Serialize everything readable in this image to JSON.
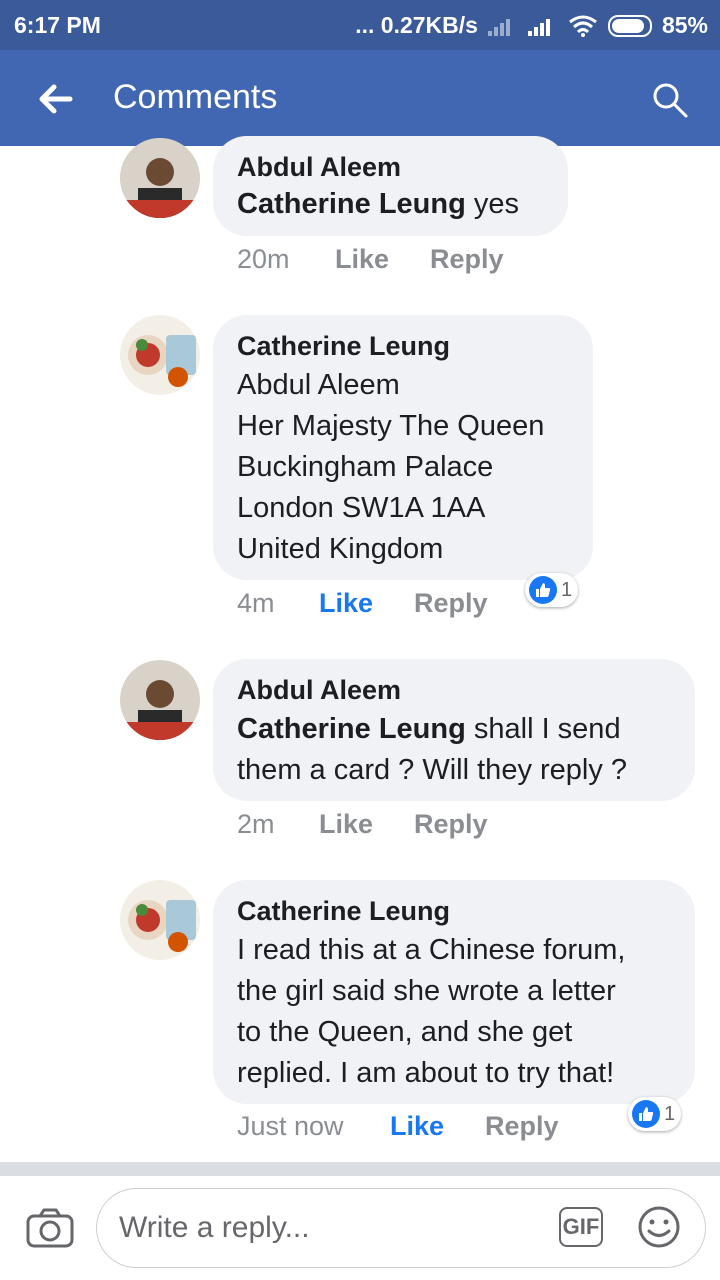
{
  "status_bar": {
    "time": "6:17 PM",
    "network_speed": "... 0.27KB/s",
    "battery": "85%"
  },
  "app_bar": {
    "title": "Comments",
    "back_icon": "arrow-left-icon",
    "search_icon": "search-icon"
  },
  "comments": [
    {
      "author": "Abdul Aleem",
      "mention": "Catherine Leung",
      "text": " yes",
      "time": "20m",
      "like_label": "Like",
      "reply_label": "Reply",
      "liked": false
    },
    {
      "author": "Catherine Leung",
      "mention": "",
      "text": "Abdul Aleem\nHer Majesty The Queen\nBuckingham Palace\nLondon SW1A 1AA\nUnited Kingdom",
      "time": "4m",
      "like_label": "Like",
      "reply_label": "Reply",
      "liked": true,
      "reaction_count": "1"
    },
    {
      "author": "Abdul Aleem",
      "mention": "Catherine Leung",
      "text": " shall I send\nthem a card ? Will they reply ?",
      "time": "2m",
      "like_label": "Like",
      "reply_label": "Reply",
      "liked": false
    },
    {
      "author": "Catherine Leung",
      "mention": "",
      "text": "I read this at a Chinese forum,\nthe girl said she wrote a letter\nto the Queen, and she get\nreplied. I am about to try that!",
      "time": "Just now",
      "like_label": "Like",
      "reply_label": "Reply",
      "liked": true,
      "reaction_count": "1"
    }
  ],
  "composer": {
    "placeholder": "Write a reply...",
    "gif_label": "GIF"
  },
  "colors": {
    "status_bar": "#3b5a9a",
    "app_bar": "#4267b2",
    "like_active": "#1877f2",
    "bubble": "#f0f2f5"
  }
}
